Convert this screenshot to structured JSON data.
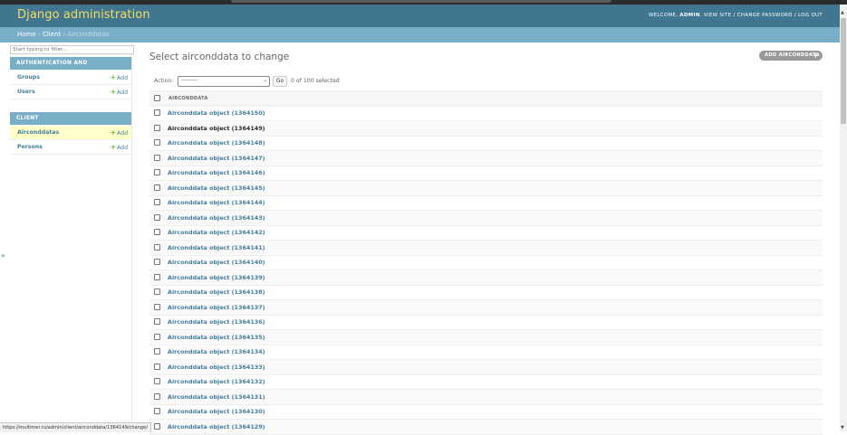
{
  "header": {
    "site_name": "Django administration",
    "welcome": "WELCOME,",
    "username": "ADMIN",
    "view_site": "VIEW SITE",
    "change_password": "CHANGE PASSWORD",
    "logout": "LOG OUT",
    "separator": "/"
  },
  "breadcrumbs": {
    "home": "Home",
    "app": "Client",
    "current": "Airconddatas",
    "sep": "›"
  },
  "sidebar": {
    "filter_placeholder": "Start typing to filter...",
    "toggle_glyph": "«",
    "add_label": "Add",
    "apps": [
      {
        "name": "AUTHENTICATION AND AUTHORIZATION",
        "models": [
          "Groups",
          "Users"
        ]
      },
      {
        "name": "CLIENT",
        "models": [
          "Airconddatas",
          "Persons"
        ]
      }
    ]
  },
  "content": {
    "title": "Select airconddata to change",
    "add_button": "ADD AIRCONDDATA",
    "action_label": "Action:",
    "action_selected": "---------",
    "go_button": "Go",
    "counter": "0 of 100 selected",
    "column_header": "AIRCONDDATA",
    "rows": [
      "Airconddata object (1364150)",
      "Airconddata object (1364149)",
      "Airconddata object (1364148)",
      "Airconddata object (1364147)",
      "Airconddata object (1364146)",
      "Airconddata object (1364145)",
      "Airconddata object (1364144)",
      "Airconddata object (1364143)",
      "Airconddata object (1364142)",
      "Airconddata object (1364141)",
      "Airconddata object (1364140)",
      "Airconddata object (1364139)",
      "Airconddata object (1364138)",
      "Airconddata object (1364137)",
      "Airconddata object (1364136)",
      "Airconddata object (1364135)",
      "Airconddata object (1364134)",
      "Airconddata object (1364133)",
      "Airconddata object (1364132)",
      "Airconddata object (1364131)",
      "Airconddata object (1364130)",
      "Airconddata object (1364129)"
    ]
  },
  "status_bar": {
    "url": "https://multimer.ru/admin/client/airconddata/1364149/change/"
  },
  "colors": {
    "header_bg": "#417690",
    "site_name": "#f5dd5d",
    "breadcrumb_bg": "#79aec8",
    "link": "#447e9b",
    "add_icon": "#70bf2b",
    "current_model_bg": "#ffffcc"
  }
}
